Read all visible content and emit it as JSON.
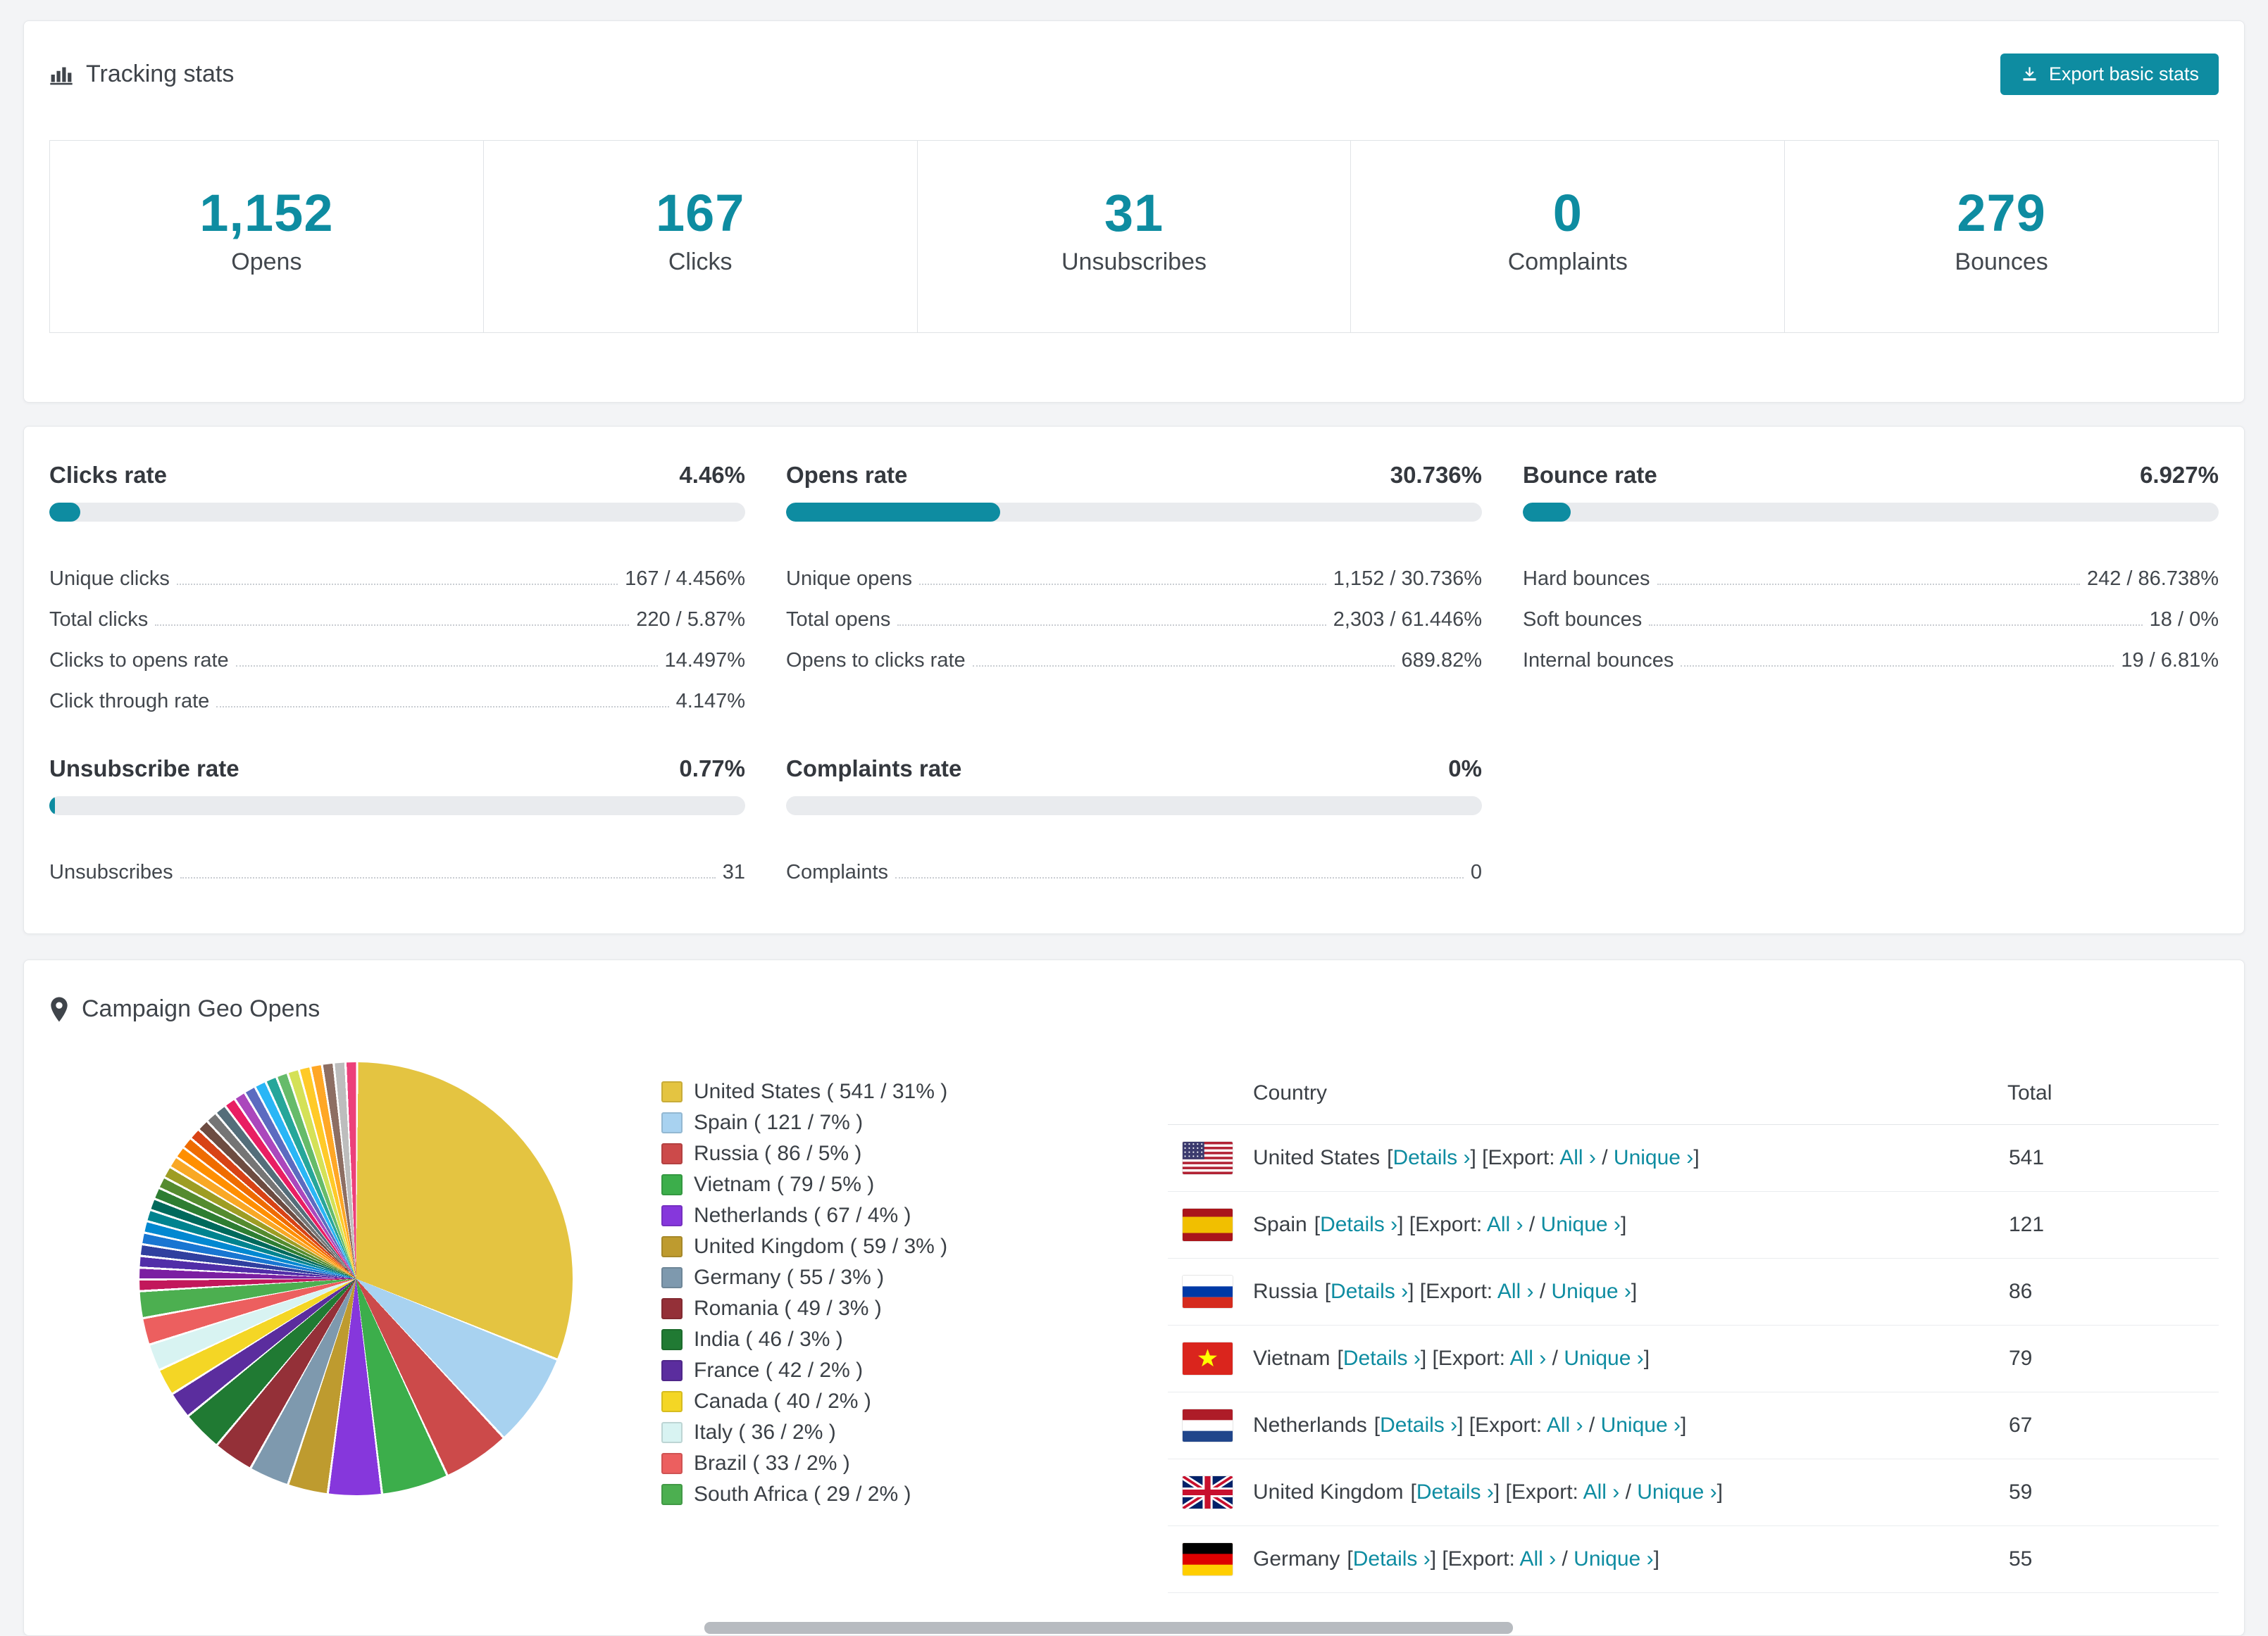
{
  "colors": {
    "accent": "#0e8ca1",
    "link": "#0e8ca1"
  },
  "header": {
    "title": "Tracking stats",
    "export_button": "Export basic stats"
  },
  "stats": [
    {
      "value": "1,152",
      "label": "Opens"
    },
    {
      "value": "167",
      "label": "Clicks"
    },
    {
      "value": "31",
      "label": "Unsubscribes"
    },
    {
      "value": "0",
      "label": "Complaints"
    },
    {
      "value": "279",
      "label": "Bounces"
    }
  ],
  "rates": {
    "clicks": {
      "title": "Clicks rate",
      "value": "4.46%",
      "percent": 4.46,
      "rows": [
        {
          "label": "Unique clicks",
          "value": "167 / 4.456%"
        },
        {
          "label": "Total clicks",
          "value": "220 / 5.87%"
        },
        {
          "label": "Clicks to opens rate",
          "value": "14.497%"
        },
        {
          "label": "Click through rate",
          "value": "4.147%"
        }
      ]
    },
    "opens": {
      "title": "Opens rate",
      "value": "30.736%",
      "percent": 30.736,
      "rows": [
        {
          "label": "Unique opens",
          "value": "1,152 / 30.736%"
        },
        {
          "label": "Total opens",
          "value": "2,303 / 61.446%"
        },
        {
          "label": "Opens to clicks rate",
          "value": "689.82%"
        }
      ]
    },
    "bounce": {
      "title": "Bounce rate",
      "value": "6.927%",
      "percent": 6.927,
      "rows": [
        {
          "label": "Hard bounces",
          "value": "242 / 86.738%"
        },
        {
          "label": "Soft bounces",
          "value": "18 / 0%"
        },
        {
          "label": "Internal bounces",
          "value": "19 / 6.81%"
        }
      ]
    },
    "unsubscribe": {
      "title": "Unsubscribe rate",
      "value": "0.77%",
      "percent": 0.77,
      "rows": [
        {
          "label": "Unsubscribes",
          "value": "31"
        }
      ]
    },
    "complaints": {
      "title": "Complaints rate",
      "value": "0%",
      "percent": 0,
      "rows": [
        {
          "label": "Complaints",
          "value": "0"
        }
      ]
    }
  },
  "geo": {
    "title": "Campaign Geo Opens",
    "table": {
      "headers": [
        "Country",
        "Total"
      ],
      "details_link": "Details ›",
      "export_label": "Export:",
      "all_link": "All ›",
      "unique_link": "Unique ›",
      "bracket_open": "[",
      "bracket_close": "]",
      "separator": "/",
      "rows": [
        {
          "country": "United States",
          "flag": "us",
          "total": "541"
        },
        {
          "country": "Spain",
          "flag": "es",
          "total": "121"
        },
        {
          "country": "Russia",
          "flag": "ru",
          "total": "86"
        },
        {
          "country": "Vietnam",
          "flag": "vn",
          "total": "79"
        },
        {
          "country": "Netherlands",
          "flag": "nl",
          "total": "67"
        },
        {
          "country": "United Kingdom",
          "flag": "gb",
          "total": "59"
        },
        {
          "country": "Germany",
          "flag": "de",
          "total": "55"
        }
      ]
    }
  },
  "chart_data": {
    "type": "pie",
    "title": "Campaign Geo Opens",
    "legend_position": "right",
    "slices": [
      {
        "label": "United States",
        "value": 541,
        "percent": 31,
        "color": "#E4C441"
      },
      {
        "label": "Spain",
        "value": 121,
        "percent": 7,
        "color": "#A8D2F0"
      },
      {
        "label": "Russia",
        "value": 86,
        "percent": 5,
        "color": "#CC4A4A"
      },
      {
        "label": "Vietnam",
        "value": 79,
        "percent": 5,
        "color": "#3CAE4B"
      },
      {
        "label": "Netherlands",
        "value": 67,
        "percent": 4,
        "color": "#8637DC"
      },
      {
        "label": "United Kingdom",
        "value": 59,
        "percent": 3,
        "color": "#BE9B2F"
      },
      {
        "label": "Germany",
        "value": 55,
        "percent": 3,
        "color": "#7E99AE"
      },
      {
        "label": "Romania",
        "value": 49,
        "percent": 3,
        "color": "#943038"
      },
      {
        "label": "India",
        "value": 46,
        "percent": 3,
        "color": "#207A33"
      },
      {
        "label": "France",
        "value": 42,
        "percent": 2,
        "color": "#5B2D9E"
      },
      {
        "label": "Canada",
        "value": 40,
        "percent": 2,
        "color": "#F4D625"
      },
      {
        "label": "Italy",
        "value": 36,
        "percent": 2,
        "color": "#D8F3F2"
      },
      {
        "label": "Brazil",
        "value": 33,
        "percent": 2,
        "color": "#EC5F5F"
      },
      {
        "label": "South Africa",
        "value": 29,
        "percent": 2,
        "color": "#4CAF50"
      }
    ],
    "others": {
      "percent_total": 26,
      "colors": [
        "#C2185B",
        "#7B1FA2",
        "#512DA8",
        "#303F9F",
        "#1976D2",
        "#0288D1",
        "#00838F",
        "#00695C",
        "#2E7D32",
        "#558B2F",
        "#9E9D24",
        "#F9A825",
        "#FF8F00",
        "#EF6C00",
        "#D84315",
        "#6D4C41",
        "#757575",
        "#546E7A",
        "#E91E63",
        "#AB47BC",
        "#5C6BC0",
        "#29B6F6",
        "#26A69A",
        "#66BB6A",
        "#D4E157",
        "#FFCA28",
        "#FFA726",
        "#8D6E63",
        "#BDBDBD",
        "#EC407A"
      ]
    }
  }
}
